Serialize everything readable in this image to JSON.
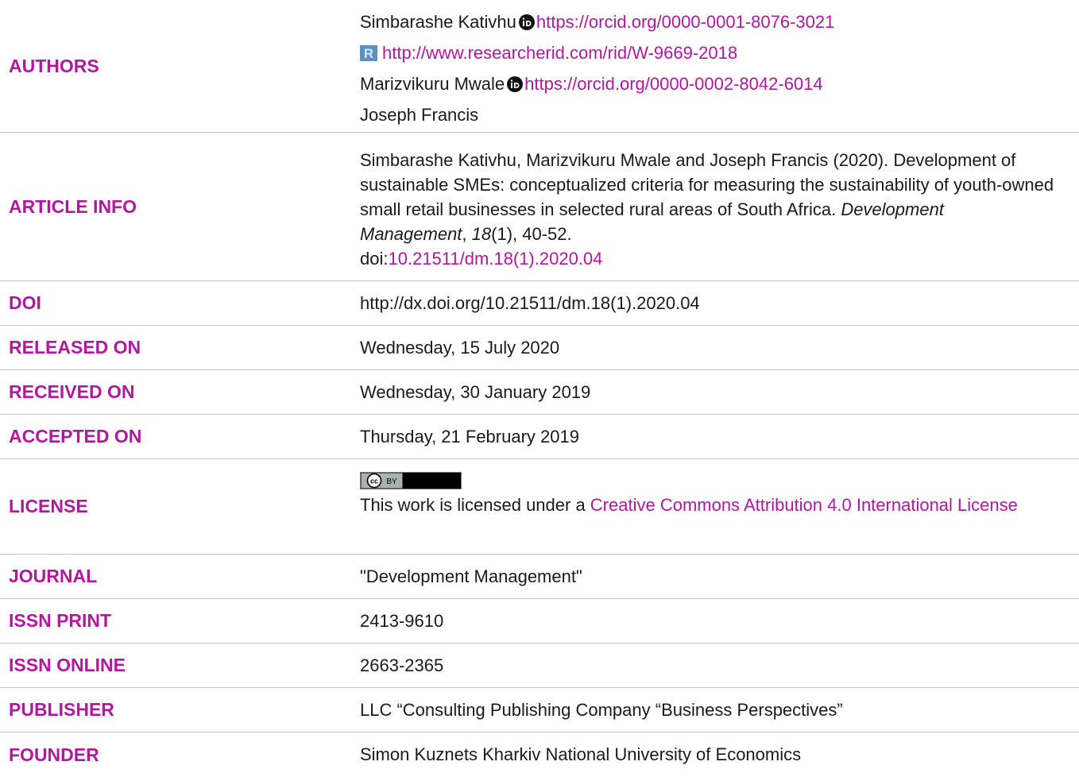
{
  "authors": {
    "label": "AUTHORS",
    "entries": [
      {
        "name": "Simbarashe Kativhu",
        "orcid": "https://orcid.org/0000-0001-8076-3021"
      },
      {
        "researcherid": "http://www.researcherid.com/rid/W-9669-2018"
      },
      {
        "name": "Marizvikuru Mwale",
        "orcid": "https://orcid.org/0000-0002-8042-6014"
      },
      {
        "name": "Joseph Francis"
      }
    ]
  },
  "article_info": {
    "label": "ARTICLE INFO",
    "citation_authors": "Simbarashe Kativhu, Marizvikuru Mwale and Joseph Francis (2020).",
    "citation_title": "Development of sustainable SMEs: conceptualized criteria for measuring the sustainability of youth-owned small retail businesses in selected rural areas of South Africa.",
    "journal": "Development Management",
    "sep1": ", ",
    "volume": "18",
    "issue_pages": "(1), 40-52.",
    "doi_prefix": "doi:",
    "doi_link": "10.21511/dm.18(1).2020.04"
  },
  "doi": {
    "label": "DOI",
    "value": "http://dx.doi.org/10.21511/dm.18(1).2020.04"
  },
  "released_on": {
    "label": "RELEASED ON",
    "value": "Wednesday, 15 July 2020"
  },
  "received_on": {
    "label": "RECEIVED ON",
    "value": "Wednesday, 30 January 2019"
  },
  "accepted_on": {
    "label": "ACCEPTED ON",
    "value": "Thursday, 21 February 2019"
  },
  "license": {
    "label": "LICENSE",
    "badge_cc": "cc",
    "badge_by": "BY",
    "text_prefix": "This work is licensed under a ",
    "link": "Creative Commons Attribution 4.0 International License"
  },
  "journal": {
    "label": "JOURNAL",
    "value": "\"Development Management\""
  },
  "issn_print": {
    "label": "ISSN PRINT",
    "value": "2413-9610"
  },
  "issn_online": {
    "label": "ISSN ONLINE",
    "value": "2663-2365"
  },
  "publisher": {
    "label": "PUBLISHER",
    "value": "LLC “Consulting Publishing Company “Business Perspectives”"
  },
  "founder": {
    "label": "FOUNDER",
    "value": "Simon Kuznets Kharkiv National University of Economics"
  },
  "colors": {
    "label": "#b0189e",
    "link": "#b0189e",
    "text": "#1a1a1a",
    "divider": "#c8c8c8"
  }
}
